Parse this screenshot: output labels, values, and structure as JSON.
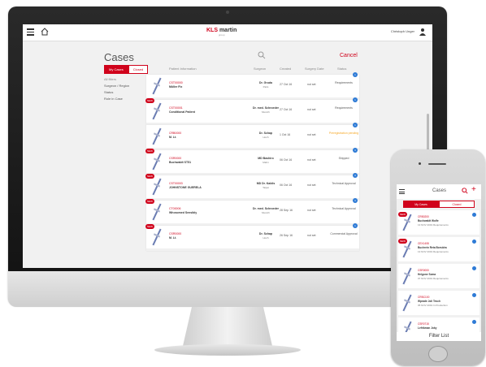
{
  "app": {
    "logo_prefix": "KLS",
    "logo_suffix": "martin",
    "logo_sub": "group",
    "user_name": "Christoph Unger",
    "title": "Cases",
    "cancel_label": "Cancel"
  },
  "toggle": {
    "my_cases": "My Cases",
    "closed": "Closed"
  },
  "filters": [
    "All filters",
    "Surgeon / Region",
    "Status",
    "Role in Case"
  ],
  "columns": {
    "patient": "Patient Information",
    "surgeon": "Surgeon",
    "created": "Created",
    "surgery": "Surgery Date",
    "status": "Status"
  },
  "cases": [
    {
      "id": "CST00000",
      "name": "Müller Fix",
      "surgeon": "Dr. Gruda",
      "location": "Paris",
      "created": "27 Oct 16",
      "surgery": "not set",
      "status": "Requirements",
      "badge": "1",
      "is_new": false,
      "warn": false
    },
    {
      "id": "CST00001",
      "name": "Conditional Patient",
      "surgeon": "Dr. med. Schroeder",
      "location": "Munich",
      "created": "27 Oct 16",
      "surgery": "not set",
      "status": "Requirements",
      "badge": "1",
      "is_new": true,
      "warn": false
    },
    {
      "id": "CRB0000",
      "name": "M. Lt.",
      "surgeon": "Dr. Schap",
      "location": "Hoch",
      "created": "1 Oct 16",
      "surgery": "not set",
      "status": "Preregistration pending",
      "badge": "1",
      "is_new": false,
      "warn": true
    },
    {
      "id": "CSR0000",
      "name": "Buchwaldt ST51",
      "surgeon": "MD Bashiro",
      "location": "Mahn",
      "created": "06 Oct 16",
      "surgery": "not set",
      "status": "Shipped",
      "badge": "3",
      "is_new": true,
      "warn": false
    },
    {
      "id": "CST00003",
      "name": "JOHNSTONE GUERELA",
      "surgeon": "MD Dr. Kaldis",
      "location": "Taipei",
      "created": "06 Oct 16",
      "surgery": "not set",
      "status": "Technical Approval",
      "badge": "3",
      "is_new": true,
      "warn": false
    },
    {
      "id": "CT00006",
      "name": "Whosomed Sensibly",
      "surgeon": "Dr. med. Schroeder",
      "location": "Munich",
      "created": "28 Sep 16",
      "surgery": "not set",
      "status": "Technical Approval",
      "badge": "3",
      "is_new": true,
      "warn": false
    },
    {
      "id": "CSR0000",
      "name": "M. Lt.",
      "surgeon": "Dr. Schap",
      "location": "Hoch",
      "created": "26 Sep 16",
      "surgery": "not set",
      "status": "Commercial Approval",
      "badge": "1",
      "is_new": true,
      "warn": false
    }
  ],
  "phone": {
    "title": "Cases",
    "toggle_my": "My Cases",
    "toggle_closed": "Closed",
    "filter_label": "Filter List",
    "cases": [
      {
        "id": "CRB0200",
        "name": "Buchwaldt Wolfe",
        "sub": "13 NOV 2019 Requirements",
        "is_new": true
      },
      {
        "id": "CEX1408",
        "name": "Buchrein Reta Borsidra",
        "sub": "13 NOV 2019 Requirements",
        "is_new": true
      },
      {
        "id": "CSR0000",
        "name": "Helgone Soma",
        "sub": "07 NOV 2019 Requirements",
        "is_new": false
      },
      {
        "id": "CRBC100",
        "name": "Wprade Joli Tesch",
        "sub": "05 NOV 2019 In Production",
        "is_new": false
      },
      {
        "id": "CSR0715",
        "name": "Lefrikman Joky",
        "sub": "",
        "is_new": false
      }
    ]
  },
  "colors": {
    "accent": "#d0021b",
    "badge": "#2e7bd6",
    "warn": "#f5a623"
  }
}
